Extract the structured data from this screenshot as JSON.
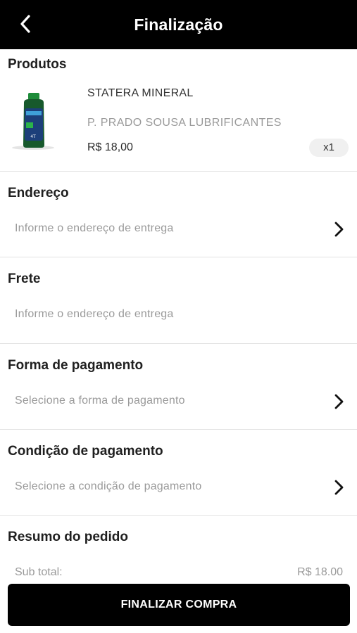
{
  "header": {
    "title": "Finalização",
    "back_icon": "chevron-left-icon"
  },
  "products": {
    "heading": "Produtos",
    "items": [
      {
        "name": "STATERA MINERAL",
        "seller": "P. PRADO SOUSA LUBRIFICANTES",
        "price": "R$ 18,00",
        "quantity": "x1"
      }
    ]
  },
  "address": {
    "heading": "Endereço",
    "placeholder": "Informe o endereço de entrega"
  },
  "shipping": {
    "heading": "Frete",
    "placeholder": "Informe o endereço de entrega"
  },
  "payment_method": {
    "heading": "Forma de pagamento",
    "placeholder": "Selecione a forma de pagamento"
  },
  "payment_condition": {
    "heading": "Condição de pagamento",
    "placeholder": "Selecione a condição de pagamento"
  },
  "summary": {
    "heading": "Resumo do pedido",
    "subtotal_label": "Sub total:",
    "subtotal_value": "R$ 18.00"
  },
  "finish_button": {
    "label": "FINALIZAR COMPRA"
  },
  "colors": {
    "header_bg": "#000000",
    "button_bg": "#000000",
    "placeholder_text": "#9a9a9a",
    "divider": "#e2e2e2"
  }
}
